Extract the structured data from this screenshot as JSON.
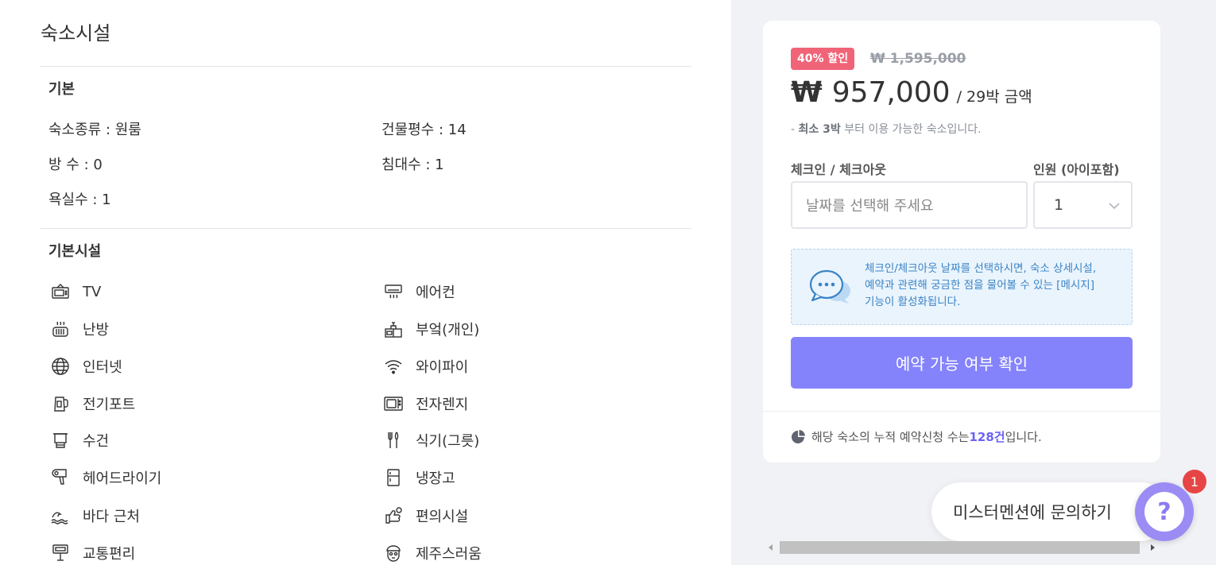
{
  "facilities_title": "숙소시설",
  "basic": {
    "heading": "기본",
    "rows": [
      {
        "label": "숙소종류 : 원룸"
      },
      {
        "label": "건물평수 : 14"
      },
      {
        "label": "방 수 : 0"
      },
      {
        "label": "침대수 : 1"
      },
      {
        "label": "욕실수 : 1"
      }
    ]
  },
  "amenities": {
    "heading": "기본시설",
    "items": [
      {
        "label": "TV",
        "icon": "tv-icon"
      },
      {
        "label": "에어컨",
        "icon": "air-conditioner-icon"
      },
      {
        "label": "난방",
        "icon": "heater-icon"
      },
      {
        "label": "부엌(개인)",
        "icon": "kitchen-icon"
      },
      {
        "label": "인터넷",
        "icon": "globe-icon"
      },
      {
        "label": "와이파이",
        "icon": "wifi-icon"
      },
      {
        "label": "전기포트",
        "icon": "kettle-icon"
      },
      {
        "label": "전자렌지",
        "icon": "microwave-icon"
      },
      {
        "label": "수건",
        "icon": "towel-icon"
      },
      {
        "label": "식기(그릇)",
        "icon": "utensils-icon"
      },
      {
        "label": "헤어드라이기",
        "icon": "hair-dryer-icon"
      },
      {
        "label": "냉장고",
        "icon": "fridge-icon"
      },
      {
        "label": "바다 근처",
        "icon": "wave-icon"
      },
      {
        "label": "편의시설",
        "icon": "convenience-icon"
      },
      {
        "label": "교통편리",
        "icon": "signpost-icon"
      },
      {
        "label": "제주스러움",
        "icon": "dolharubang-icon"
      }
    ]
  },
  "booking": {
    "discount_badge": "40% 할인",
    "original_price": "₩ 1,595,000",
    "currency_symbol": "₩",
    "price": "957,000",
    "price_suffix": "/ 29박 금액",
    "min_stay_prefix": "- ",
    "min_stay_bold": "최소 3박",
    "min_stay_rest": " 부터 이용 가능한 숙소입니다.",
    "date_label": "체크인 / 체크아웃",
    "guests_label": "인원 (아이포함)",
    "date_placeholder": "날짜를 선택해 주세요",
    "guests_value": "1",
    "notice_line1": "체크인/체크아웃 날짜를 선택하시면, 숙소 상세시설,",
    "notice_line2": "예약과 관련해 궁금한 점을 물어볼 수 있는 [메시지]",
    "notice_line3": "기능이 활성화됩니다.",
    "cta_label": "예약 가능 여부 확인",
    "stats_prefix": "해당 숙소의 누적 예약신청 수는 ",
    "stats_count": "128건",
    "stats_suffix": " 입니다."
  },
  "chat": {
    "inquiry_label": "미스터멘션에 문의하기",
    "help_glyph": "?",
    "badge_count": "1"
  },
  "colors": {
    "accent": "#8583fb",
    "discount": "#f06478",
    "notice_text": "#3a83c5",
    "notif": "#e74545"
  }
}
